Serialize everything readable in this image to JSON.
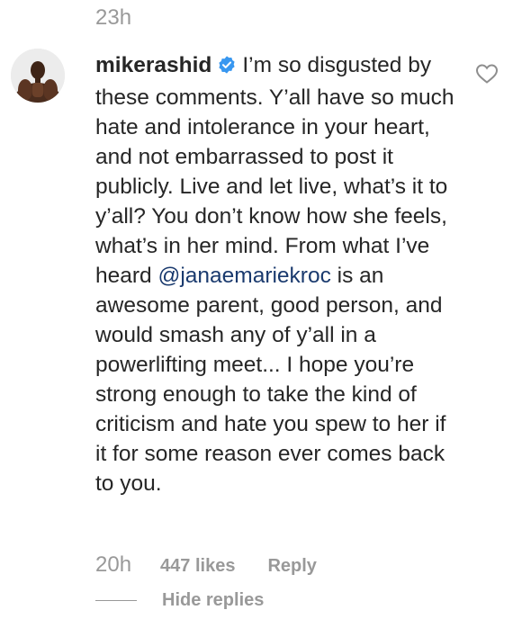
{
  "previous_comment": {
    "timestamp": "23h"
  },
  "comment": {
    "avatar_icon": "user-avatar-photo",
    "username": "mikerashid",
    "verified_icon": "verified-badge-icon",
    "verified_color": "#3897f0",
    "text_part1": "I’m so disgusted by these comments. Y’all have so much hate and intolerance in your heart, and not embarrassed to post it publicly. Live and let live, what’s it to y’all? You don’t know how she feels, what’s in her mind. From what I’ve heard ",
    "mention": "@janaemariekroc",
    "text_part2": " is an awesome parent, good person, and would smash any of y’all in a powerlifting meet... I hope you’re strong enough to take the kind of criticism and hate you spew to her if it for some reason ever comes back to you.",
    "like_icon": "heart-outline-icon",
    "timestamp": "20h",
    "likes": "447 likes",
    "reply_label": "Reply"
  },
  "replies": {
    "toggle_label": "Hide replies"
  },
  "colors": {
    "text": "#262626",
    "muted": "#999999",
    "mention": "#1a3a6e"
  }
}
